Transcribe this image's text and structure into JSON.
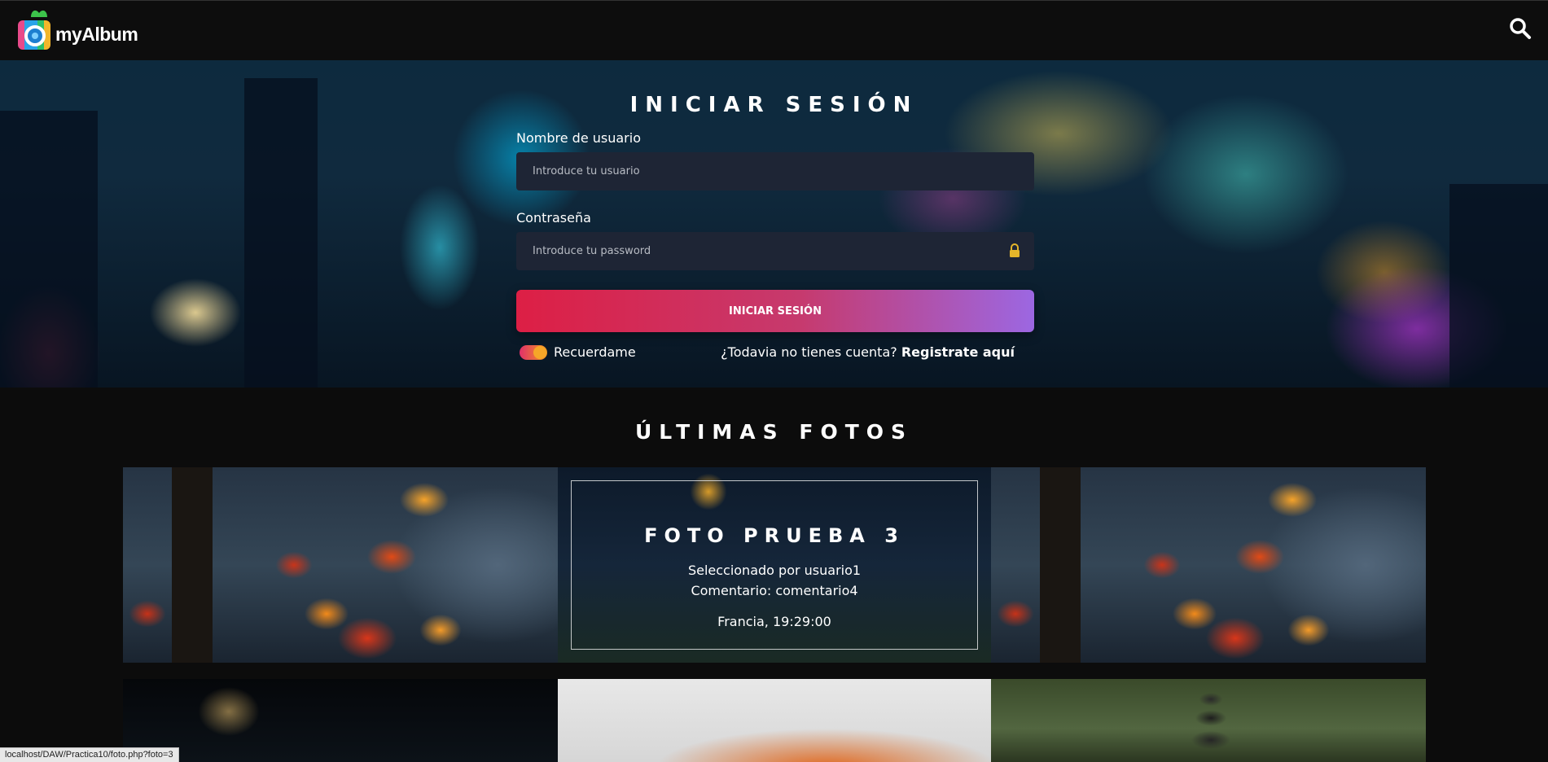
{
  "header": {
    "brand": "myAlbum",
    "search_icon": "search-icon"
  },
  "hero": {
    "title": "INICIAR SESIÓN",
    "username_label": "Nombre de usuario",
    "username_placeholder": "Introduce tu usuario",
    "password_label": "Contraseña",
    "password_placeholder": "Introduce tu password",
    "password_icon": "lock-icon",
    "submit_label": "INICIAR SESIÓN",
    "remember_label": "Recuerdame",
    "remember_checked": true,
    "register_prompt": "¿Todavia no tienes cuenta?",
    "register_link": "Registrate aquí"
  },
  "latest": {
    "title": "ÚLTIMAS FOTOS",
    "featured": {
      "title": "FOTO PRUEBA 3",
      "selected_by": "Seleccionado por usuario1",
      "comment": "Comentario: comentario4",
      "place_time": "Francia, 19:29:00"
    }
  },
  "status_bar": {
    "url": "localhost/DAW/Practica10/foto.php?foto=3"
  },
  "colors": {
    "background": "#0c0c0c",
    "field_bg": "#1e2535",
    "button_gradient_start": "#dd1f45",
    "button_gradient_end": "#9c67e2",
    "toggle_start": "#e0306a",
    "toggle_end": "#f39a1f"
  }
}
